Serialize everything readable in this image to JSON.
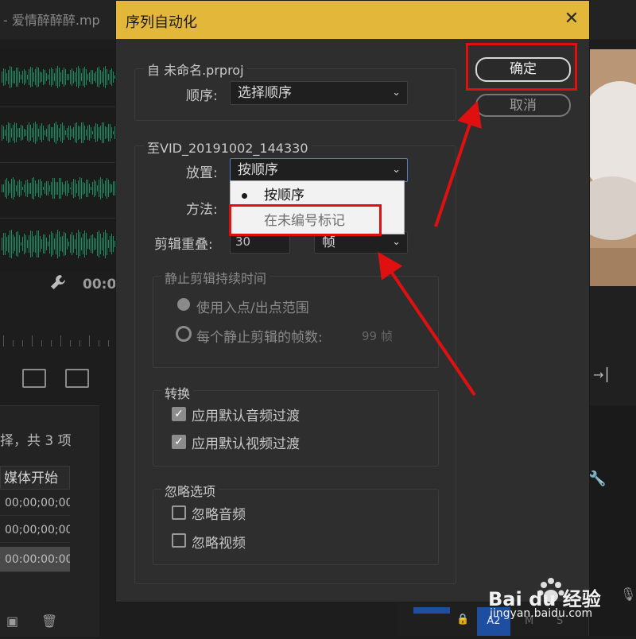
{
  "background": {
    "source_tab": "- 爱情醉醉醉.mp",
    "timecode": "00:0",
    "items_count": "择，共 3 项",
    "column_header": "媒体开始",
    "media_rows": [
      "00;00;00;00",
      "00;00;00;00",
      "00:00:00:00"
    ],
    "track_label": "A2",
    "track_m": "M",
    "track_s": "S"
  },
  "dialog": {
    "title": "序列自动化",
    "from_group": {
      "legend": "自 未命名.prproj",
      "order_label": "顺序:",
      "order_value": "选择顺序"
    },
    "to_group": {
      "legend": "至VID_20191002_144330",
      "placement_label": "放置:",
      "placement_value": "按顺序",
      "method_label": "方法:",
      "overlap_label": "剪辑重叠:",
      "overlap_value": "30",
      "overlap_unit": "帧"
    },
    "placement_dropdown": {
      "options": [
        "按顺序",
        "在未编号标记"
      ],
      "selected_index": 0
    },
    "still_group": {
      "legend": "静止剪辑持续时间",
      "option_in_out": "使用入点/出点范围",
      "option_frames": "每个静止剪辑的帧数:",
      "frames_value": "99 帧"
    },
    "transitions_group": {
      "legend": "转换",
      "audio": "应用默认音频过渡",
      "video": "应用默认视频过渡",
      "audio_checked": true,
      "video_checked": true
    },
    "ignore_group": {
      "legend": "忽略选项",
      "ignore_audio": "忽略音频",
      "ignore_video": "忽略视频",
      "ignore_audio_checked": false,
      "ignore_video_checked": false
    },
    "buttons": {
      "ok": "确定",
      "cancel": "取消"
    }
  },
  "watermark": {
    "brand": "Bai du 经验",
    "url": "jingyan.baidu.com"
  },
  "colors": {
    "titlebar": "#e2b73a",
    "annotation_red": "#e01010",
    "waveform_green": "#1f8a5f"
  }
}
